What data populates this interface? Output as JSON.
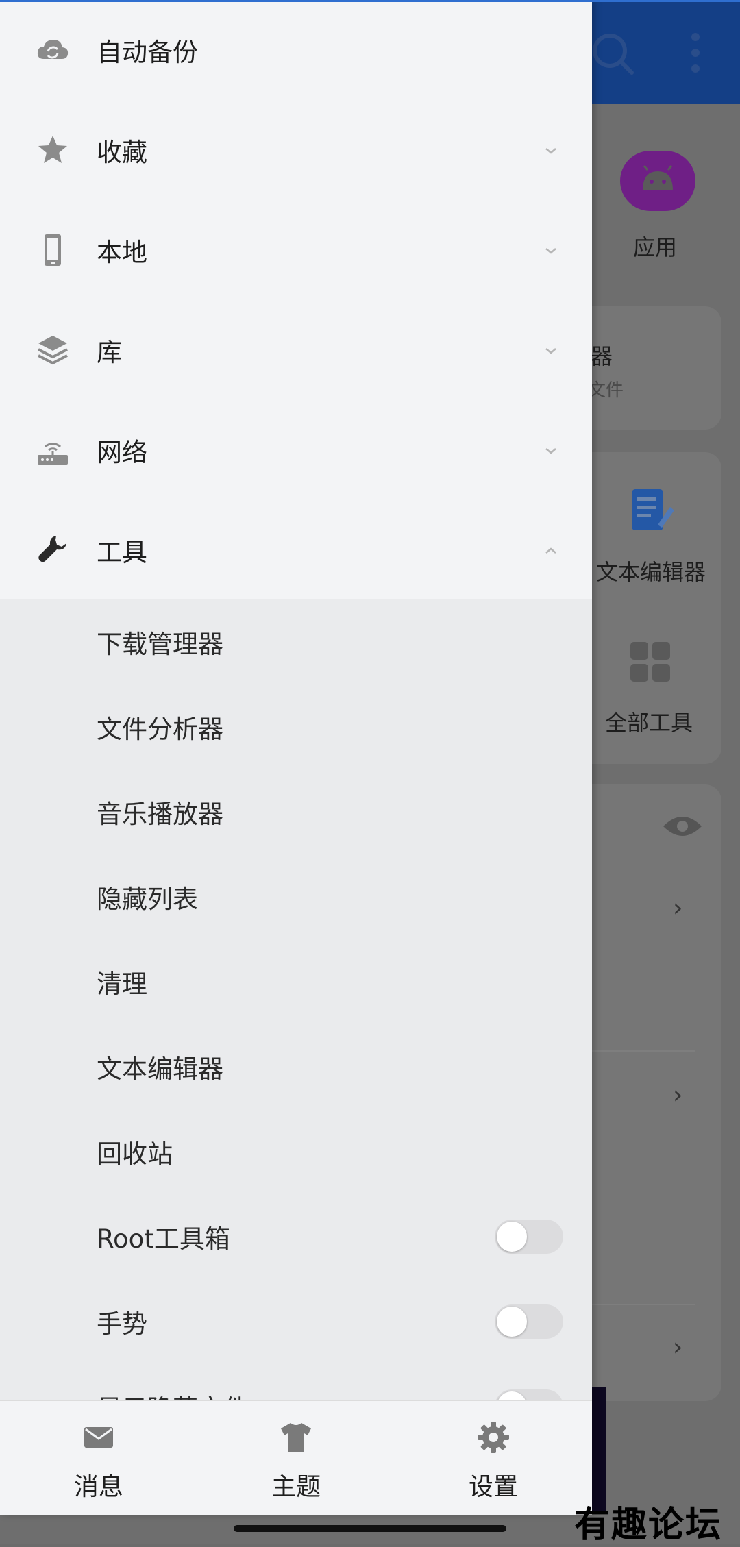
{
  "drawer": {
    "items": [
      {
        "label": "自动备份",
        "icon": "cloud-sync-icon",
        "chevron": "none"
      },
      {
        "label": "收藏",
        "icon": "star-icon",
        "chevron": "down"
      },
      {
        "label": "本地",
        "icon": "phone-icon",
        "chevron": "down"
      },
      {
        "label": "库",
        "icon": "layers-icon",
        "chevron": "down"
      },
      {
        "label": "网络",
        "icon": "router-icon",
        "chevron": "down"
      },
      {
        "label": "工具",
        "icon": "wrench-icon",
        "chevron": "up"
      }
    ],
    "tools": [
      {
        "label": "下载管理器"
      },
      {
        "label": "文件分析器"
      },
      {
        "label": "音乐播放器"
      },
      {
        "label": "隐藏列表"
      },
      {
        "label": "清理"
      },
      {
        "label": "文本编辑器"
      },
      {
        "label": "回收站"
      },
      {
        "label": "Root工具箱",
        "toggle": false
      },
      {
        "label": "手势",
        "toggle": false
      },
      {
        "label": "显示隐藏文件",
        "toggle": false
      }
    ],
    "bottom_tabs": [
      {
        "label": "消息",
        "icon": "mail-icon"
      },
      {
        "label": "主题",
        "icon": "tshirt-icon"
      },
      {
        "label": "设置",
        "icon": "gear-icon"
      }
    ]
  },
  "background": {
    "apps_label": "应用",
    "card_title_fragment": "器",
    "card_sub_fragment": "文件",
    "tool_text_editor": "文本编辑器",
    "tool_all": "全部工具"
  },
  "watermark": "有趣论坛",
  "colors": {
    "topbar": "#143f86",
    "drawer_bg": "#f3f4f6",
    "tools_bg": "#eaebed",
    "accent_line": "#2f6fd0"
  }
}
